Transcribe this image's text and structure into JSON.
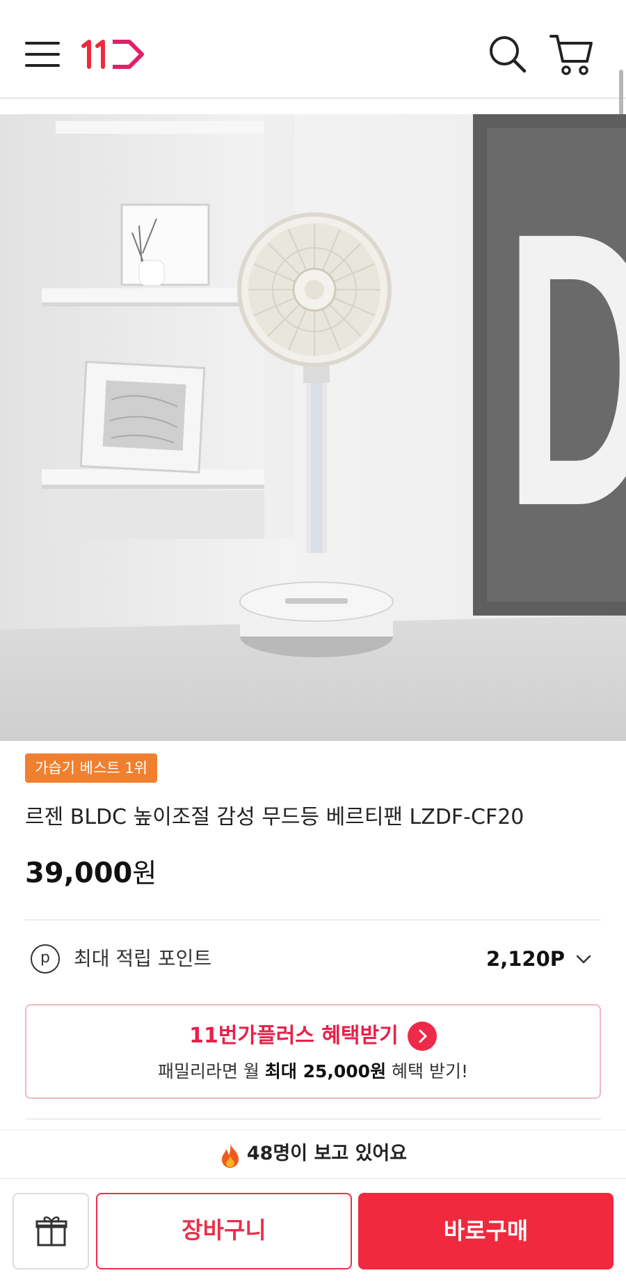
{
  "header": {
    "logo_alt": "11번가",
    "icons": [
      "menu-icon",
      "logo",
      "search-icon",
      "cart-icon"
    ]
  },
  "product": {
    "badge": "가습기 베스트 1위",
    "title": "르젠 BLDC 높이조절 감성 무드등 베르티팬 LZDF-CF20",
    "price_number": "39,000",
    "price_unit": "원",
    "hero_poster_text": "DA"
  },
  "points": {
    "icon_letter": "p",
    "label": "최대 적립 포인트",
    "value": "2,120P"
  },
  "plus": {
    "title_a": "11번가플러스",
    "title_b": " 혜택받기",
    "sub_a": "패밀리라면 월 ",
    "sub_bold": "최대 25,000원",
    "sub_b": " 혜택 받기!"
  },
  "viewers": {
    "text": "48명이 보고 있어요"
  },
  "bottom": {
    "cart_label": "장바구니",
    "buy_label": "바로구매"
  },
  "colors": {
    "accent_red": "#f0293e",
    "badge_orange": "#f0802f",
    "plus_magenta": "#c0107a"
  }
}
